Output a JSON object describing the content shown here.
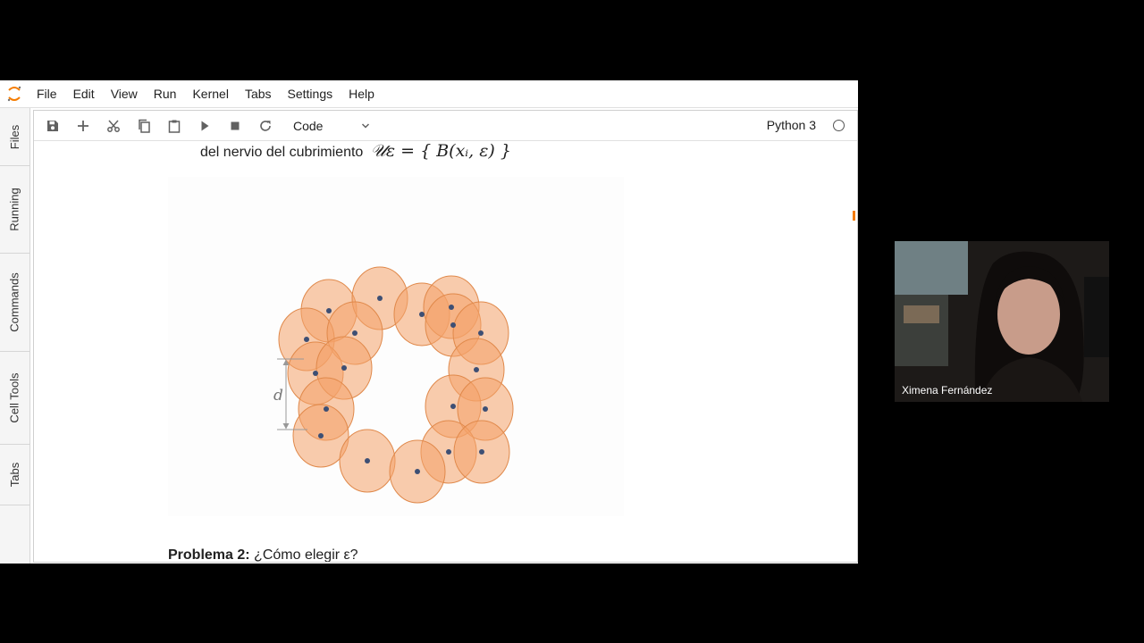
{
  "menubar": {
    "items": [
      "File",
      "Edit",
      "View",
      "Run",
      "Kernel",
      "Tabs",
      "Settings",
      "Help"
    ]
  },
  "sidebar": {
    "tabs": [
      "Files",
      "Running",
      "Commands",
      "Cell Tools",
      "Tabs"
    ]
  },
  "toolbar": {
    "cell_type": "Code",
    "kernel_name": "Python 3",
    "icons": [
      "save-icon",
      "plus-icon",
      "cut-icon",
      "copy-icon",
      "paste-icon",
      "run-icon",
      "stop-icon",
      "restart-icon",
      "chevron-down-icon",
      "circle-icon"
    ]
  },
  "content": {
    "text_line": "del nervio del cubrimiento",
    "math_expr": "𝒰ε = { B(xᵢ, ε) }",
    "figure_label": "d",
    "problem_bold": "Problema 2:",
    "problem_text": "¿Cómo elegir ε?"
  },
  "video": {
    "participant_name": "Ximena Fernández"
  },
  "colors": {
    "accent": "#f57c00",
    "circle_fill": "#f4a26a",
    "circle_stroke": "#e0894b",
    "dot": "#3d4f74"
  }
}
